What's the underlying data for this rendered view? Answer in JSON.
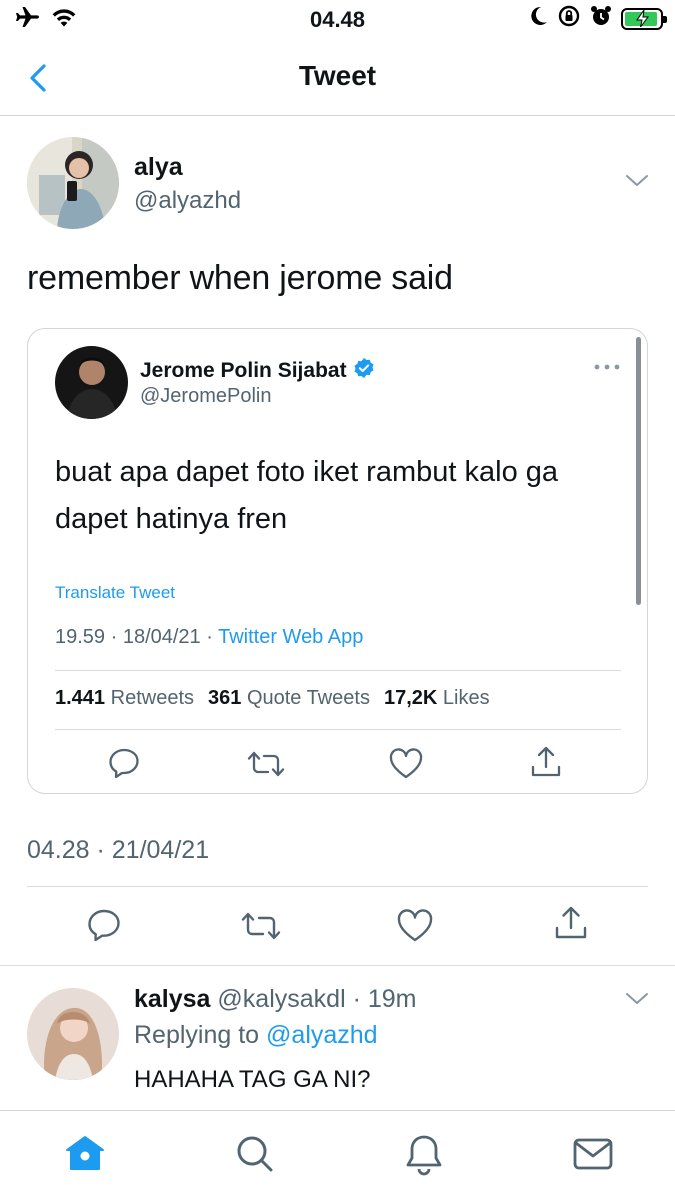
{
  "status_bar": {
    "time": "04.48",
    "icons": [
      "airplane-icon",
      "wifi-icon",
      "moon-icon",
      "orientation-lock-icon",
      "alarm-icon",
      "battery-charging-icon"
    ]
  },
  "header": {
    "title": "Tweet",
    "back_icon": "chevron-left-icon"
  },
  "main_tweet": {
    "author_name": "alya",
    "author_handle": "@alyazhd",
    "text": "remember when jerome said",
    "timestamp": "04.28 · 21/04/21",
    "actions": [
      "reply-icon",
      "retweet-icon",
      "like-icon",
      "share-icon"
    ]
  },
  "quoted_tweet": {
    "author_name": "Jerome Polin Sijabat",
    "verified": true,
    "author_handle": "@JeromePolin",
    "text": "buat apa dapet foto iket rambut kalo ga dapet hatinya fren",
    "translate_label": "Translate Tweet",
    "time_date": "19.59 · 18/04/21 · ",
    "source": "Twitter Web App",
    "retweets_count": "1.441",
    "retweets_label": "Retweets",
    "quotes_count": "361",
    "quotes_label": "Quote Tweets",
    "likes_count": "17,2K",
    "likes_label": "Likes"
  },
  "reply": {
    "author_name": "kalysa",
    "author_handle": "@kalysakdl",
    "time": "· 19m",
    "replying_prefix": "Replying to ",
    "replying_to": "@alyazhd",
    "text": "HAHAHA TAG GA NI?"
  },
  "tab_bar": {
    "tabs": [
      "home-icon",
      "search-icon",
      "notifications-icon",
      "messages-icon"
    ],
    "active": "home-icon"
  },
  "colors": {
    "accent": "#1d9bf0",
    "secondary_text": "#536471",
    "divider": "#d7dce0"
  }
}
